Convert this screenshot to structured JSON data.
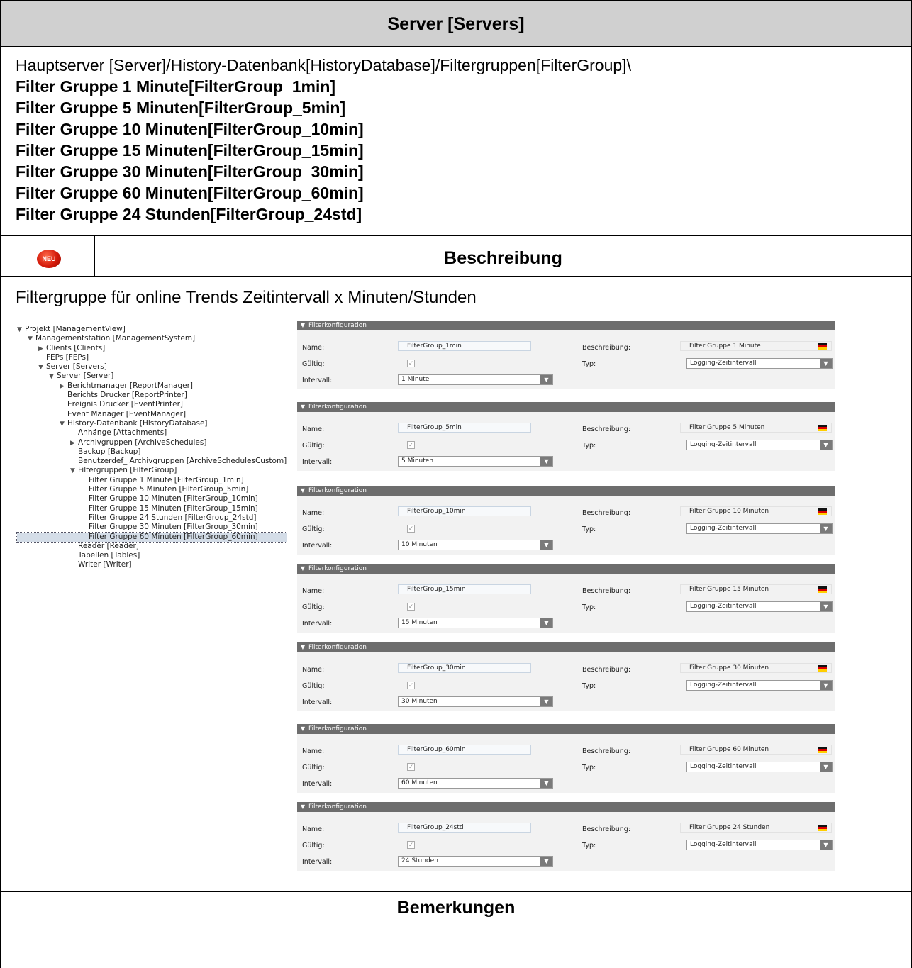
{
  "header": {
    "title": "Server [Servers]"
  },
  "path": {
    "prefix": "Hauptserver [Server]/History-Datenbank[HistoryDatabase]/Filtergruppen[FilterGroup]\\",
    "items": [
      "Filter Gruppe 1 Minute[FilterGroup_1min]",
      "Filter Gruppe 5 Minuten[FilterGroup_5min]",
      "Filter Gruppe 10 Minuten[FilterGroup_10min]",
      "Filter Gruppe 15 Minuten[FilterGroup_15min]",
      "Filter Gruppe 30 Minuten[FilterGroup_30min]",
      "Filter Gruppe 60 Minuten[FilterGroup_60min]",
      "Filter Gruppe 24 Stunden[FilterGroup_24std]"
    ]
  },
  "badge": {
    "label": "NEU"
  },
  "beschreibung": {
    "title": "Beschreibung",
    "text": "Filtergruppe für online Trends Zeitintervall x Minuten/Stunden"
  },
  "bemerkungen": {
    "title": "Bemerkungen"
  },
  "tree": [
    {
      "label": "Projekt [ManagementView]",
      "indent": 0,
      "arrow": "down"
    },
    {
      "label": "Managementstation [ManagementSystem]",
      "indent": 1,
      "arrow": "down"
    },
    {
      "label": "Clients [Clients]",
      "indent": 2,
      "arrow": "right"
    },
    {
      "label": "FEPs [FEPs]",
      "indent": 2,
      "arrow": "none"
    },
    {
      "label": "Server [Servers]",
      "indent": 2,
      "arrow": "down"
    },
    {
      "label": "Server [Server]",
      "indent": 3,
      "arrow": "down"
    },
    {
      "label": "Berichtmanager [ReportManager]",
      "indent": 4,
      "arrow": "right"
    },
    {
      "label": "Berichts Drucker [ReportPrinter]",
      "indent": 4,
      "arrow": "none"
    },
    {
      "label": "Ereignis Drucker [EventPrinter]",
      "indent": 4,
      "arrow": "none"
    },
    {
      "label": "Event Manager [EventManager]",
      "indent": 4,
      "arrow": "none"
    },
    {
      "label": "History-Datenbank [HistoryDatabase]",
      "indent": 4,
      "arrow": "down"
    },
    {
      "label": "Anhänge [Attachments]",
      "indent": 5,
      "arrow": "none"
    },
    {
      "label": "Archivgruppen [ArchiveSchedules]",
      "indent": 5,
      "arrow": "right"
    },
    {
      "label": "Backup [Backup]",
      "indent": 5,
      "arrow": "none"
    },
    {
      "label": "Benutzerdef_ Archivgruppen [ArchiveSchedulesCustom]",
      "indent": 5,
      "arrow": "none"
    },
    {
      "label": "Filtergruppen [FilterGroup]",
      "indent": 5,
      "arrow": "down"
    },
    {
      "label": "Filter Gruppe 1 Minute [FilterGroup_1min]",
      "indent": 6,
      "arrow": "none"
    },
    {
      "label": "Filter Gruppe 5 Minuten [FilterGroup_5min]",
      "indent": 6,
      "arrow": "none"
    },
    {
      "label": "Filter Gruppe 10 Minuten [FilterGroup_10min]",
      "indent": 6,
      "arrow": "none"
    },
    {
      "label": "Filter Gruppe 15 Minuten [FilterGroup_15min]",
      "indent": 6,
      "arrow": "none"
    },
    {
      "label": "Filter Gruppe 24 Stunden [FilterGroup_24std]",
      "indent": 6,
      "arrow": "none"
    },
    {
      "label": "Filter Gruppe 30 Minuten [FilterGroup_30min]",
      "indent": 6,
      "arrow": "none"
    },
    {
      "label": "Filter Gruppe 60 Minuten [FilterGroup_60min]",
      "indent": 6,
      "arrow": "none",
      "selected": true
    },
    {
      "label": "Reader [Reader]",
      "indent": 5,
      "arrow": "none"
    },
    {
      "label": "Tabellen [Tables]",
      "indent": 5,
      "arrow": "none"
    },
    {
      "label": "Writer [Writer]",
      "indent": 5,
      "arrow": "none"
    }
  ],
  "panel_labels": {
    "header": "Filterkonfiguration",
    "name": "Name:",
    "gueltig": "Gültig:",
    "intervall": "Intervall:",
    "beschreibung": "Beschreibung:",
    "typ": "Typ:",
    "typ_value": "Logging-Zeitintervall",
    "checkmark": "✓"
  },
  "panels": [
    {
      "name": "FilterGroup_1min",
      "beschreibung": "Filter Gruppe 1 Minute",
      "intervall": "1 Minute"
    },
    {
      "name": "FilterGroup_5min",
      "beschreibung": "Filter Gruppe 5 Minuten",
      "intervall": "5 Minuten"
    },
    {
      "name": "FilterGroup_10min",
      "beschreibung": "Filter Gruppe 10 Minuten",
      "intervall": "10 Minuten"
    },
    {
      "name": "FilterGroup_15min",
      "beschreibung": "Filter Gruppe 15 Minuten",
      "intervall": "15 Minuten"
    },
    {
      "name": "FilterGroup_30min",
      "beschreibung": "Filter Gruppe 30 Minuten",
      "intervall": "30 Minuten"
    },
    {
      "name": "FilterGroup_60min",
      "beschreibung": "Filter Gruppe 60 Minuten",
      "intervall": "60 Minuten"
    },
    {
      "name": "FilterGroup_24std",
      "beschreibung": "Filter Gruppe 24 Stunden",
      "intervall": "24 Stunden"
    }
  ]
}
